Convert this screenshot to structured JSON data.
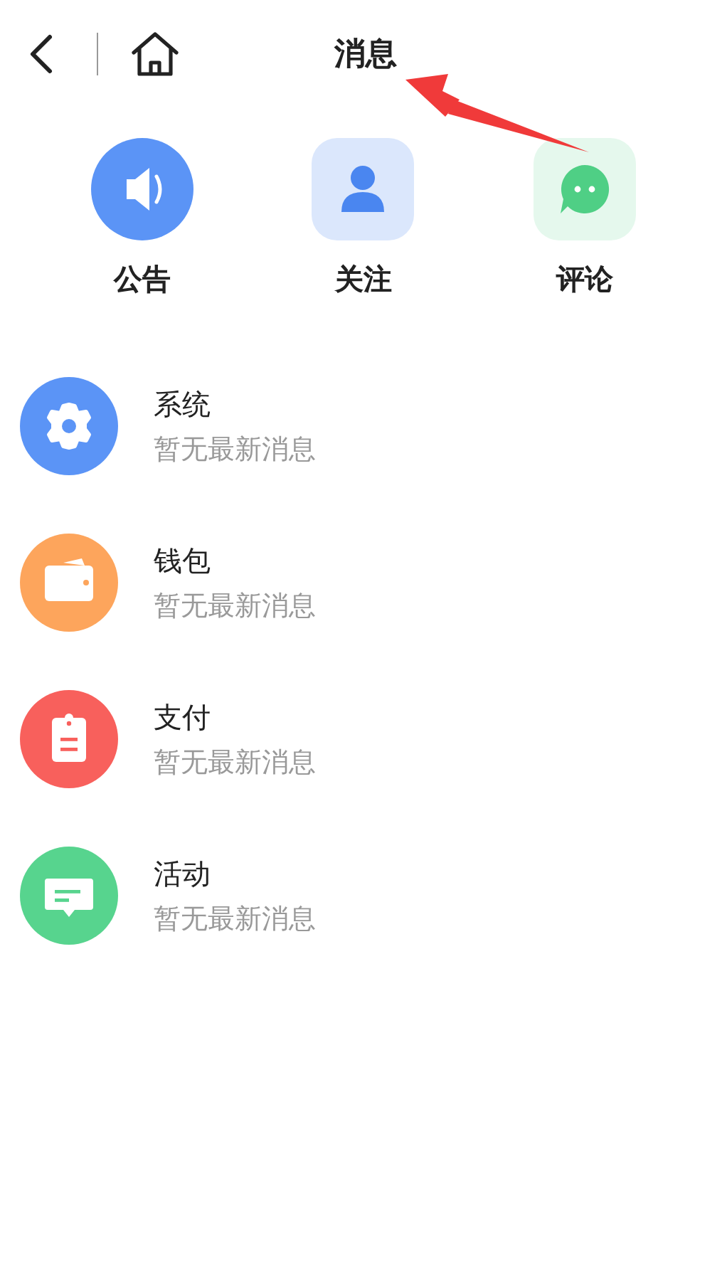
{
  "header": {
    "title": "消息"
  },
  "shortcuts": [
    {
      "kind": "speaker",
      "label": "公告",
      "color": "#5b94f6"
    },
    {
      "kind": "person",
      "label": "关注",
      "color": "#4a86f0"
    },
    {
      "kind": "chat",
      "label": "评论",
      "color": "#4fcf85"
    }
  ],
  "messages": [
    {
      "kind": "gear",
      "title": "系统",
      "subtitle": "暂无最新消息",
      "color": "#5b94f6"
    },
    {
      "kind": "wallet",
      "title": "钱包",
      "subtitle": "暂无最新消息",
      "color": "#fda55c"
    },
    {
      "kind": "clipboard",
      "title": "支付",
      "subtitle": "暂无最新消息",
      "color": "#f8605c"
    },
    {
      "kind": "comment",
      "title": "活动",
      "subtitle": "暂无最新消息",
      "color": "#57d48e"
    }
  ],
  "annotation": {
    "kind": "arrow"
  }
}
